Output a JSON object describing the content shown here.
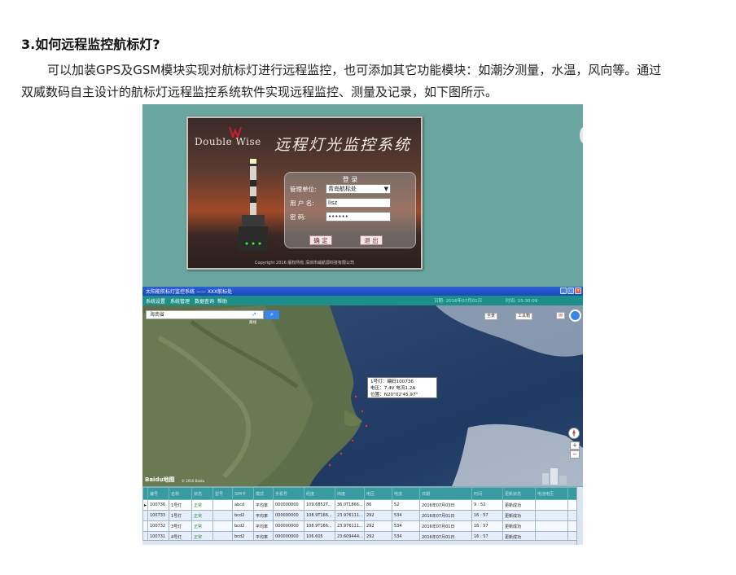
{
  "article": {
    "heading": "3.如何远程监控航标灯?",
    "paragraph_line1": "可以加装GPS及GSM模块实现对航标灯进行远程监控，也可添加其它功能模块：如潮汐测量，水温，风向等。通过",
    "paragraph_line2": "双威数码自主设计的航标灯远程监控系统软件实现远程监控、测量及记录，如下图所示。"
  },
  "login_screen": {
    "logo_text": "Double Wise",
    "system_title": "远程灯光监控系统",
    "panel_title": "登 录",
    "unit_label": "管理单位:",
    "unit_value": "青岛航标处",
    "user_label": "用 户 名:",
    "user_value": "lisz",
    "password_label": "密    码:",
    "password_value": "••••••",
    "confirm_button": "确 定",
    "exit_button": "退 出",
    "copyright": "Copyright 2016 版权所有 深圳市威航源科技有限公司"
  },
  "app": {
    "window_title": "太阳能航标灯监控系统 —— XXX航标处",
    "menu": [
      "系统设置",
      "系统管理",
      "数据查询",
      "帮助"
    ],
    "date_label": "日期: 2016年07月01日",
    "time_label": "时间: 15:30:09"
  },
  "map": {
    "search_placeholder": "海南省",
    "search_button": "⌕",
    "route_icon": "↗",
    "route_label": "路线",
    "ctrl_labels": [
      "全景",
      "工具箱"
    ],
    "share_icon": "✉",
    "info_line1": "1号灯：编码100736",
    "info_line2": "电压：7.4V  电流1.2A",
    "info_line3": "位置：N20°02'45.97\"",
    "zoom_in": "+",
    "zoom_out": "−",
    "baidu_logo": "Baidu地图",
    "scale_label": "© 2016 Baidu"
  },
  "table": {
    "headers": [
      "编号",
      "名称",
      "状态",
      "型号",
      "SIM卡",
      "模式",
      "手机号",
      "经度",
      "纬度",
      "电压",
      "电流",
      "日期",
      "时间",
      "更新状态",
      "电池电压",
      ""
    ],
    "rows": [
      [
        "100736",
        "1号灯",
        "正常",
        "",
        "abcd",
        "平均率",
        "000000000",
        "109.6852T...",
        "36.0T1866...",
        "86",
        "52",
        "2016年07月03日",
        "9 : 52",
        "更新成功",
        "",
        ""
      ],
      [
        "100733",
        "1号灯",
        "正常",
        "",
        "bcd2",
        "平均率",
        "000000000",
        "108.9T166...",
        "23.976111...",
        "292",
        "534",
        "2016年07月01日",
        "16 : 57",
        "更新成功",
        "",
        ""
      ],
      [
        "100732",
        "3号灯",
        "正常",
        "",
        "bcd2",
        "平均率",
        "000000000",
        "108.9T166...",
        "23.976111...",
        "292",
        "534",
        "2016年07月01日",
        "16 : 57",
        "更新成功",
        "",
        ""
      ],
      [
        "100731",
        "4号灯",
        "正常",
        "",
        "bcd2",
        "平均率",
        "000000000",
        "106.605",
        "23.609444...",
        "292",
        "534",
        "2016年07月01日",
        "16 : 57",
        "更新成功",
        "",
        ""
      ]
    ]
  }
}
